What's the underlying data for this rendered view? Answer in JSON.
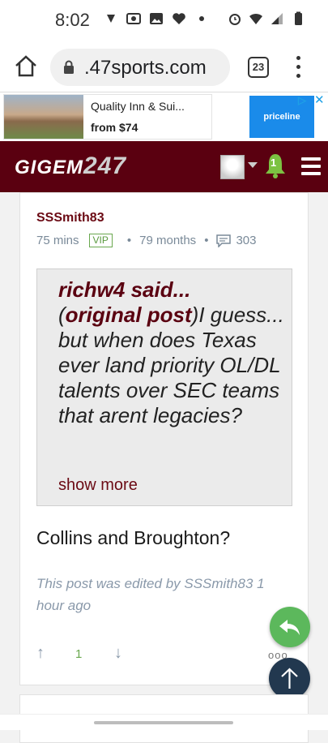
{
  "status_bar": {
    "time": "8:02",
    "left_icons": [
      "app-notification-icon",
      "radio-icon",
      "image-icon",
      "heart-icon",
      "dot-icon"
    ],
    "right_icons": [
      "alarm-icon",
      "wifi-icon",
      "signal-icon",
      "battery-icon"
    ]
  },
  "browser": {
    "url": ".47sports.com",
    "tab_count": "23"
  },
  "ad": {
    "title": "Quality Inn & Sui...",
    "price": "from $74",
    "brand": "priceline"
  },
  "site": {
    "logo_text": "GIGEM",
    "logo_number": "247",
    "notification_count": "1",
    "colors": {
      "header": "#5a0010",
      "accent": "#6b0a14",
      "vip_green": "#6aa84f"
    }
  },
  "post": {
    "author": "SSSmith83",
    "posted_ago": "75 mins",
    "badge": "VIP",
    "tenure": "79 months",
    "comment_count": "303",
    "quote": {
      "author": "richw4 said...",
      "link_label": "original post",
      "text": "I guess... but when does Texas ever land priority OL/DL talents over SEC teams that arent legacies?",
      "show_more": "show more"
    },
    "body": "Collins and Broughton?",
    "edit_note": "This post was edited by SSSmith83 1 hour ago",
    "vote_count": "1",
    "more_label": "ooo"
  }
}
